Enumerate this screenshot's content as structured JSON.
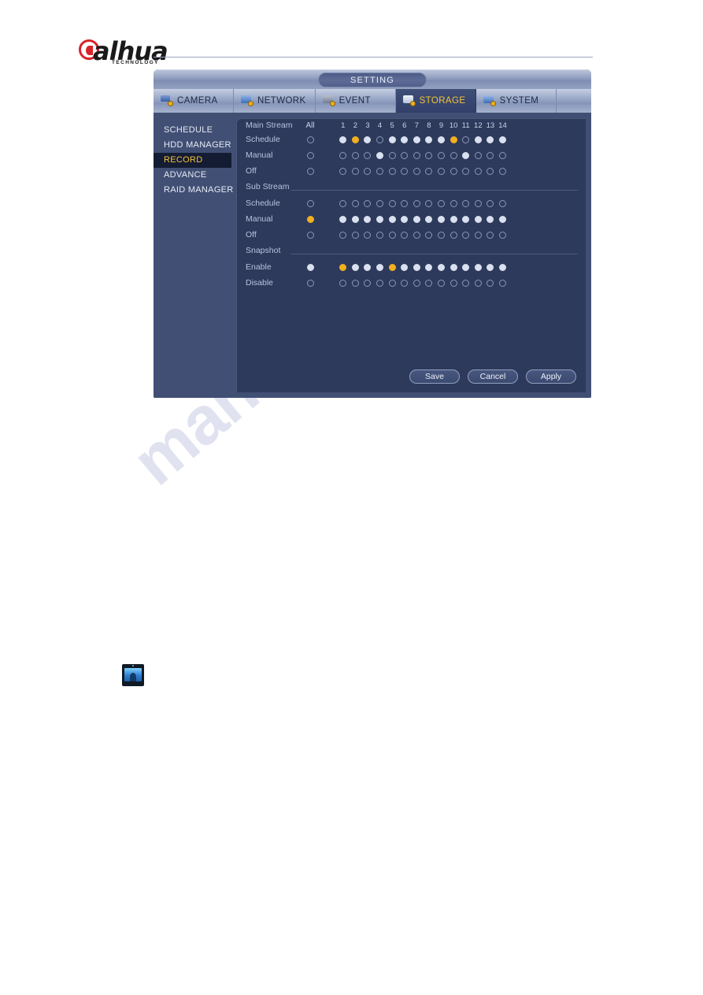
{
  "brand": {
    "name": "alhua",
    "tagline": "TECHNOLOGY"
  },
  "watermark": {
    "text": "manualshive.com"
  },
  "window": {
    "title": "SETTING",
    "tabs": [
      {
        "label": "CAMERA",
        "icon": "camera-icon",
        "active": false
      },
      {
        "label": "NETWORK",
        "icon": "network-icon",
        "active": false
      },
      {
        "label": "EVENT",
        "icon": "event-icon",
        "active": false
      },
      {
        "label": "STORAGE",
        "icon": "storage-icon",
        "active": true
      },
      {
        "label": "SYSTEM",
        "icon": "system-icon",
        "active": false
      }
    ]
  },
  "sidebar": {
    "items": [
      {
        "label": "SCHEDULE",
        "active": false
      },
      {
        "label": "HDD MANAGER",
        "active": false
      },
      {
        "label": "RECORD",
        "active": true
      },
      {
        "label": "ADVANCE",
        "active": false
      },
      {
        "label": "RAID MANAGER",
        "active": false
      }
    ]
  },
  "record": {
    "all_label": "All",
    "channels": [
      "1",
      "2",
      "3",
      "4",
      "5",
      "6",
      "7",
      "8",
      "9",
      "10",
      "11",
      "12",
      "13",
      "14"
    ],
    "sections": [
      {
        "title": "Main Stream",
        "title_is_header_row": true,
        "rows": [
          {
            "label": "Schedule",
            "all": "off",
            "states": [
              "white",
              "amber",
              "white",
              "off",
              "white",
              "white",
              "white",
              "white",
              "white",
              "amber",
              "off",
              "white",
              "white",
              "white"
            ]
          },
          {
            "label": "Manual",
            "all": "off",
            "states": [
              "off",
              "off",
              "off",
              "white",
              "off",
              "off",
              "off",
              "off",
              "off",
              "off",
              "white",
              "off",
              "off",
              "off"
            ]
          },
          {
            "label": "Off",
            "all": "off",
            "states": [
              "off",
              "off",
              "off",
              "off",
              "off",
              "off",
              "off",
              "off",
              "off",
              "off",
              "off",
              "off",
              "off",
              "off"
            ]
          }
        ]
      },
      {
        "title": "Sub Stream",
        "title_is_header_row": false,
        "rows": [
          {
            "label": "Schedule",
            "all": "off",
            "states": [
              "off",
              "off",
              "off",
              "off",
              "off",
              "off",
              "off",
              "off",
              "off",
              "off",
              "off",
              "off",
              "off",
              "off"
            ]
          },
          {
            "label": "Manual",
            "all": "amber",
            "states": [
              "white",
              "white",
              "white",
              "white",
              "white",
              "white",
              "white",
              "white",
              "white",
              "white",
              "white",
              "white",
              "white",
              "white"
            ]
          },
          {
            "label": "Off",
            "all": "off",
            "states": [
              "off",
              "off",
              "off",
              "off",
              "off",
              "off",
              "off",
              "off",
              "off",
              "off",
              "off",
              "off",
              "off",
              "off"
            ]
          }
        ]
      },
      {
        "title": "Snapshot",
        "title_is_header_row": false,
        "rows": [
          {
            "label": "Enable",
            "all": "white",
            "states": [
              "amber",
              "white",
              "white",
              "white",
              "amber",
              "white",
              "white",
              "white",
              "white",
              "white",
              "white",
              "white",
              "white",
              "white"
            ]
          },
          {
            "label": "Disable",
            "all": "off",
            "states": [
              "off",
              "off",
              "off",
              "off",
              "off",
              "off",
              "off",
              "off",
              "off",
              "off",
              "off",
              "off",
              "off",
              "off"
            ]
          }
        ]
      }
    ]
  },
  "footer": {
    "buttons": [
      {
        "label": "Save"
      },
      {
        "label": "Cancel"
      },
      {
        "label": "Apply"
      }
    ]
  },
  "colors": {
    "accent_amber": "#f2b01e",
    "window_body": "#414f74",
    "panel_bg": "#2e3a5c",
    "selected_item_bg": "#141c33",
    "brand_red": "#d8232a"
  }
}
